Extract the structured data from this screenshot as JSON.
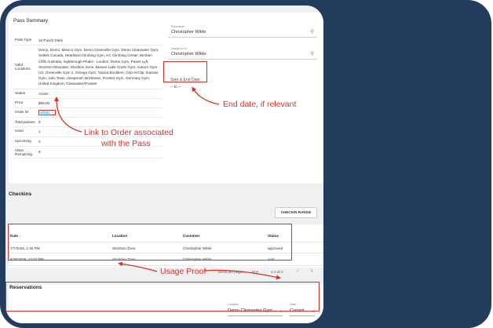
{
  "pass_summary": {
    "title": "Pass Summary",
    "rows": [
      {
        "label": "Pass Type",
        "value": "10 Punch Pass"
      },
      {
        "label": "Valid Locations",
        "value": "Demo, Demo, Mexico Gym, Demo Greenville Gym, Demo Clearwater Gym, Selkirk Canada, Heartland Climbing Gym, KC Climbing Center, Bimberi Cliffs Australia, Inglebrough Peaks - London, Demo Gym, Power Lyft, Stockton Mountain, Stockton Zone, Beaver Lake Crush Gym, Auburn Gym - US, Greenville Gym 2, Omega Gym, Topout Boulders, Grip-N-Clip, Inactive Gym, Julio Town, dosaproof, Bricktown, Frontier Gym, Germany Gym, United Kingdom, Clearwater/Frontier"
      },
      {
        "label": "Status",
        "value": "Active"
      },
      {
        "label": "Price",
        "value": "$99.00"
      },
      {
        "label": "Order ID",
        "value": "80582"
      },
      {
        "label": "Total passes",
        "value": "9"
      },
      {
        "label": "Used",
        "value": "1"
      },
      {
        "label": "Upcoming",
        "value": "0"
      },
      {
        "label": "Visits Remaining",
        "value": "8"
      }
    ]
  },
  "fields": {
    "purchaser_label": "Purchaser",
    "purchaser_value": "Christopher Wilde",
    "assigned_label": "Assigned to",
    "assigned_value": "Christopher Wilde",
    "date_label": "Start & End Date",
    "date_value": "-- to --"
  },
  "checkins": {
    "title": "Checkins",
    "button": "CHECKIN RANGE",
    "headers": {
      "date": "Date",
      "location": "Location",
      "customer": "Customer",
      "status": "Status"
    },
    "rows": [
      {
        "date": "7/7/2026, 1:35 PM",
        "location": "Stockton Zone",
        "customer": "Christopher Wilde",
        "status": "approved"
      },
      {
        "date": "6/25/2026, 12:53 PM",
        "location": "Stockton Zone",
        "customer": "Christopher Wilde",
        "status": "void"
      }
    ],
    "pager": {
      "items_label": "Items per page:",
      "items_value": "10",
      "range": "1-2 of 2",
      "prev": "‹",
      "next": "›"
    }
  },
  "reservations": {
    "title": "Reservations",
    "location_label": "Location",
    "location_value": "Demo Clearwater Gym",
    "date_label": "Date",
    "date_value": "Current"
  },
  "annotations": {
    "end_date": "End date, if relevant",
    "order_link_line1": "Link to Order associated",
    "order_link_line2": "with the Pass",
    "usage": "Usage Proof"
  },
  "colors": {
    "annotation": "#d93025",
    "frame": "#233c5e",
    "link": "#1e88e5"
  },
  "icons": [
    "search-icon",
    "search-icon",
    "sort-arrow-icon",
    "caret-down-icon",
    "chevron-left-icon",
    "chevron-right-icon"
  ]
}
